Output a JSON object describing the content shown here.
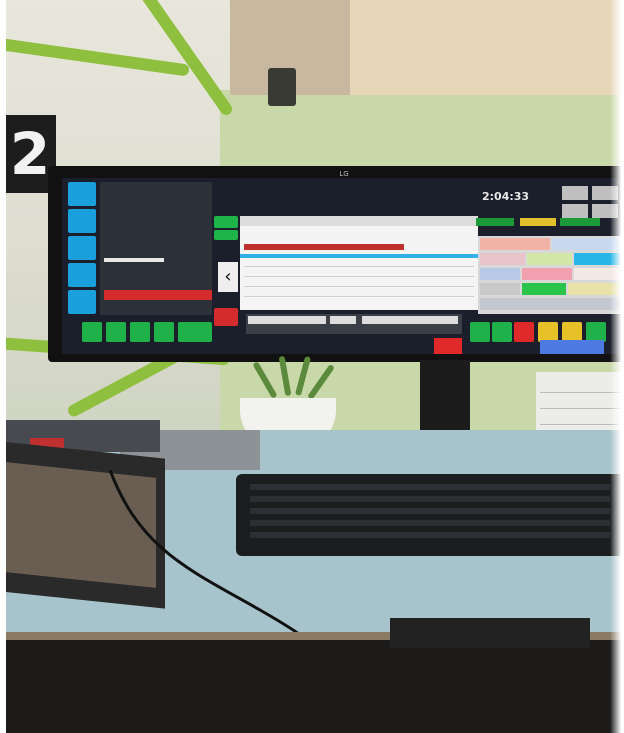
{
  "scene": {
    "wall_number": "2",
    "monitor": {
      "brand": "LG",
      "clock": "2:04:33",
      "left_panel": {
        "lines": [
          "",
          "",
          "",
          "",
          "",
          ""
        ]
      }
    }
  },
  "colors": {
    "wall": "#e9e7dc",
    "green_stripe": "#8fbf3e",
    "desk": "#a7c3cc",
    "monitor_bezel": "#111111",
    "ui_blue": "#1aa0dc",
    "ui_green": "#1fb44a",
    "ui_red": "#d42c2c"
  },
  "icons": [
    "chevron-left-icon"
  ]
}
